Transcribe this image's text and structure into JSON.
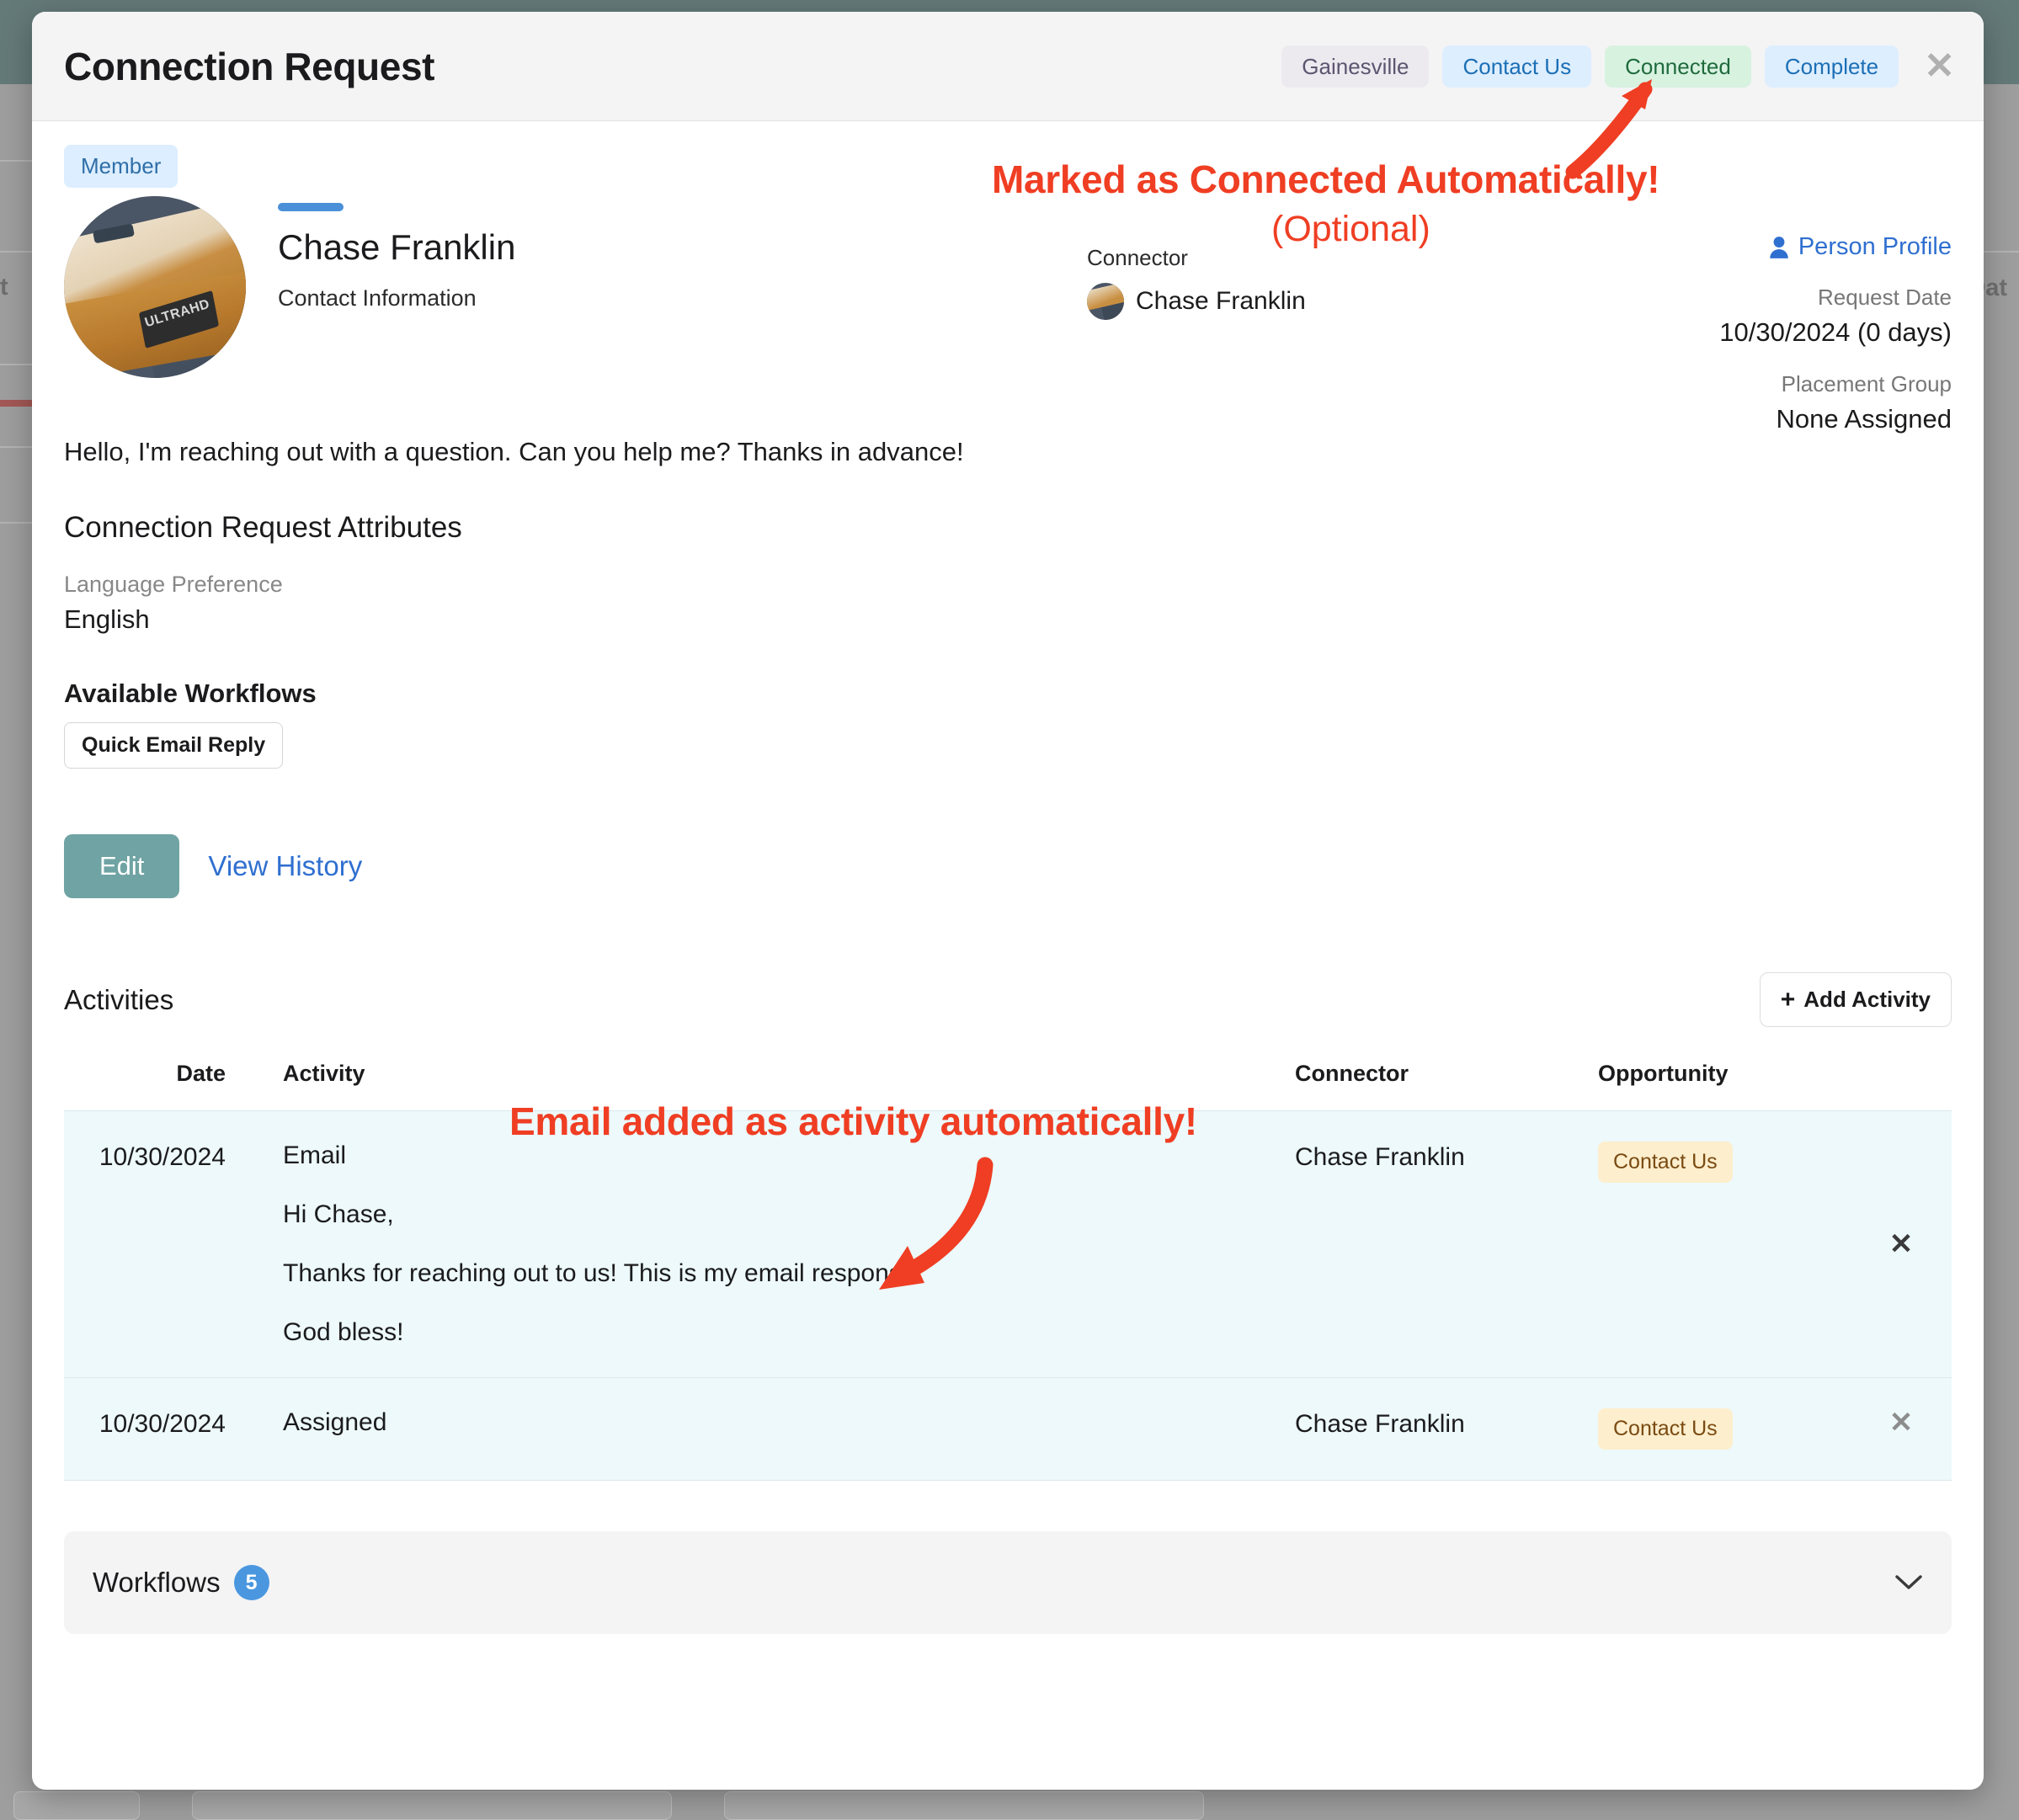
{
  "background": {
    "left_partial_text": "t",
    "right_partial_text": "Dat"
  },
  "modal": {
    "title": "Connection Request",
    "header_badges": [
      {
        "label": "Gainesville",
        "style": "gray"
      },
      {
        "label": "Contact Us",
        "style": "blue"
      },
      {
        "label": "Connected",
        "style": "green"
      },
      {
        "label": "Complete",
        "style": "blue"
      }
    ],
    "close_label": "✕"
  },
  "profile": {
    "member_badge": "Member",
    "name": "Chase Franklin",
    "contact_information_label": "Contact Information",
    "connector_label": "Connector",
    "connector_name": "Chase Franklin",
    "person_profile_link": "Person Profile",
    "request_date_label": "Request Date",
    "request_date_value": "10/30/2024 (0 days)",
    "placement_group_label": "Placement Group",
    "placement_group_value": "None Assigned"
  },
  "content": {
    "intro_message": "Hello, I'm reaching out with a question. Can you help me? Thanks in advance!",
    "attributes_heading": "Connection Request Attributes",
    "attributes": [
      {
        "label": "Language Preference",
        "value": "English"
      }
    ],
    "available_workflows_heading": "Available Workflows",
    "available_workflows": [
      "Quick Email Reply"
    ],
    "edit_label": "Edit",
    "view_history_label": "View History"
  },
  "activities": {
    "title": "Activities",
    "add_button_label": "Add Activity",
    "add_button_icon": "plus-icon",
    "columns": [
      "Date",
      "Activity",
      "Connector",
      "Opportunity"
    ],
    "rows": [
      {
        "date": "10/30/2024",
        "activity": "Email",
        "body_lines": [
          "Hi Chase,",
          "Thanks for reaching out to us! This is my email response.",
          "God bless!"
        ],
        "connector": "Chase Franklin",
        "opportunity": "Contact Us",
        "delete_label": "✕"
      },
      {
        "date": "10/30/2024",
        "activity": "Assigned",
        "body_lines": [],
        "connector": "Chase Franklin",
        "opportunity": "Contact Us",
        "delete_label": "✕"
      }
    ]
  },
  "workflows_panel": {
    "title": "Workflows",
    "count": "5",
    "chevron": "⌄"
  },
  "annotations": {
    "connected_note": "Marked as Connected Automatically!",
    "optional_note": "(Optional)",
    "email_note": "Email added as activity automatically!"
  },
  "colors": {
    "annotation_red": "#ef3e23",
    "edit_button": "#70a3a3",
    "link_blue": "#2f6fd0",
    "badge_green_bg": "#d8f2e0",
    "badge_blue_bg": "#ddeeff",
    "opportunity_chip_bg": "#fdeecd",
    "activity_row_bg": "#edf9fb",
    "page_topbar": "#647a79"
  }
}
